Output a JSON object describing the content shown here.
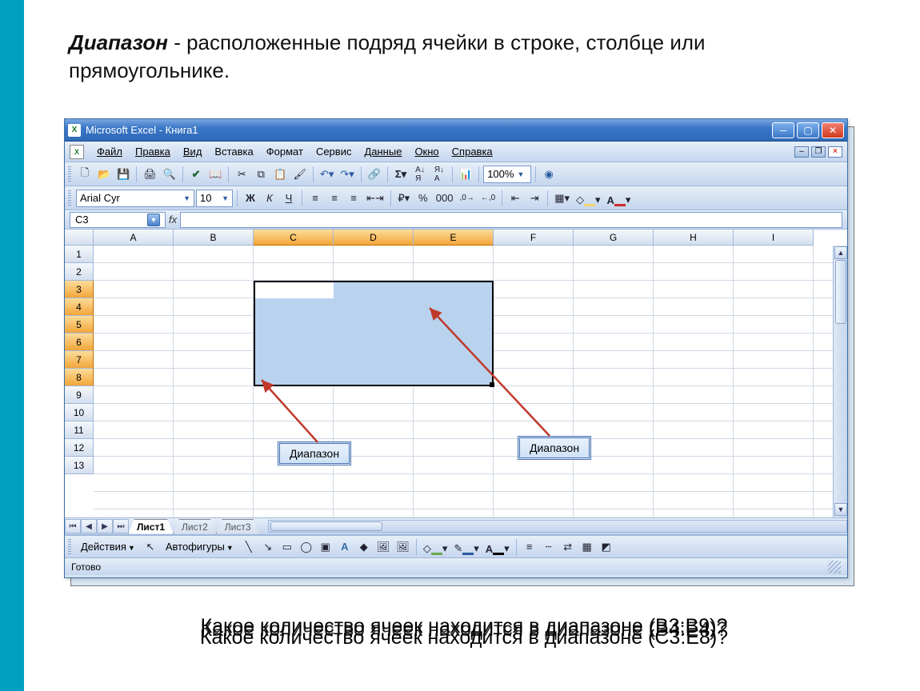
{
  "slide": {
    "heading_bold": "Диапазон",
    "heading_rest": " - расположенные подряд ячейки в строке, столбце или прямоугольнике."
  },
  "window": {
    "title": "Microsoft Excel - Книга1"
  },
  "menu": {
    "file": "Файл",
    "edit": "Правка",
    "view": "Вид",
    "insert": "Вставка",
    "format": "Формат",
    "tools": "Сервис",
    "data": "Данные",
    "window_m": "Окно",
    "help": "Справка"
  },
  "toolbar1": {
    "zoom": "100%"
  },
  "toolbar2": {
    "font": "Arial Cyr",
    "size": "10",
    "bold": "Ж",
    "italic": "К",
    "underline": "Ч"
  },
  "formulabar": {
    "namebox": "C3",
    "fx": "fx"
  },
  "columns": [
    "A",
    "B",
    "C",
    "D",
    "E",
    "F",
    "G",
    "H",
    "I"
  ],
  "rows": [
    "1",
    "2",
    "3",
    "4",
    "5",
    "6",
    "7",
    "8",
    "9",
    "10",
    "11",
    "12",
    "13"
  ],
  "callouts": {
    "left": "Диапазон",
    "right": "Диапазон"
  },
  "tabs": {
    "active": "Лист1",
    "t2": "Лист2",
    "t3": "Лист3"
  },
  "drawbar": {
    "actions": "Действия",
    "autoshapes": "Автофигуры"
  },
  "status": {
    "ready": "Готово"
  },
  "bottom": {
    "line1": "Какое количество ячеек находится в диапазоне (B3:B9)?",
    "line2": "Какое количество ячеек находится в диапазоне (C3:E8)?",
    "line3": "Какое количество ячеек находится в диапазоне (B4:E4)?"
  }
}
